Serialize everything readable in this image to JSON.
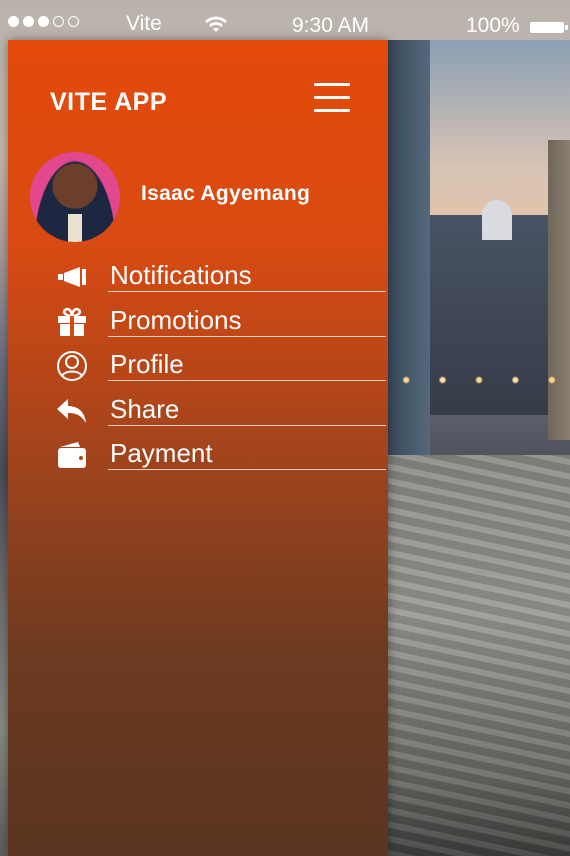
{
  "status_bar": {
    "signal_dots_filled": 3,
    "signal_dots_total": 5,
    "carrier": "Vite",
    "time": "9:30 AM",
    "battery": "100%"
  },
  "menu_panel": {
    "app_title": "VITE APP",
    "user": {
      "name": "Isaac Agyemang"
    },
    "items": [
      {
        "label": "Notifications",
        "icon": "megaphone-icon"
      },
      {
        "label": "Promotions",
        "icon": "gift-icon"
      },
      {
        "label": "Profile",
        "icon": "user-circle-icon"
      },
      {
        "label": "Share",
        "icon": "share-arrow-icon"
      },
      {
        "label": "Payment",
        "icon": "wallet-icon"
      }
    ]
  },
  "colors": {
    "panel_top": "#e44a0a",
    "panel_bottom": "#5a3521",
    "text": "#ffffff",
    "screen_border": "#cfe3b4"
  }
}
